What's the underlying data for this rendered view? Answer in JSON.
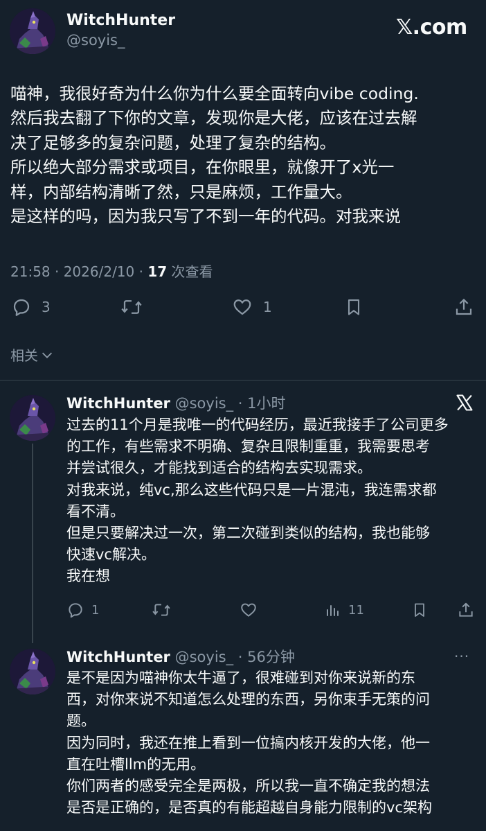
{
  "main_post": {
    "author_name": "WitchHunter",
    "author_handle": "@soyis_",
    "brand_label": "𝕏.com",
    "text_lines": [
      "喵神，我很好奇为什么你为什么要全面转向vibe coding.",
      "然后我去翻了下你的文章，发现你是大佬，应该在过去解",
      "决了足够多的复杂问题，处理了复杂的结构。",
      "所以绝大部分需求或项目，在你眼里，就像开了x光一",
      "样，内部结构清晰了然，只是麻烦，工作量大。",
      "是这样的吗，因为我只写了不到一年的代码。对我来说"
    ],
    "timestamp": "21:58 · 2026/2/10 · ",
    "view_count": "17",
    "view_label": " 次查看",
    "reply_count": "3",
    "like_count": "1",
    "related_label": "相关"
  },
  "replies": [
    {
      "author_name": "WitchHunter",
      "author_handle": "@soyis_",
      "time": " · 1小时",
      "text_lines": [
        "过去的11个月是我唯一的代码经历，最近我接手了公司更多",
        "的工作，有些需求不明确、复杂且限制重重，我需要思考",
        "并尝试很久，才能找到适合的结构去实现需求。",
        "对我来说，纯vc,那么这些代码只是一片混沌，我连需求都",
        "看不清。",
        "但是只要解决过一次，第二次碰到类似的结构，我也能够",
        "快速vc解决。",
        "我在想"
      ],
      "reply_count": "1",
      "view_count": "11"
    },
    {
      "author_name": "WitchHunter",
      "author_handle": "@soyis_",
      "time": " · 56分钟",
      "more_label": "···",
      "text_lines": [
        "是不是因为喵神你太牛逼了，很难碰到对你来说新的东",
        "西，对你来说不知道怎么处理的东西，另你束手无策的问",
        "题。",
        "因为同时，我还在推上看到一位搞内核开发的大佬，他一",
        "直在吐槽llm的无用。",
        "你们两者的感受完全是两极，所以我一直不确定我的想法",
        "是否是正确的，是否真的有能超越自身能力限制的vc架构"
      ]
    }
  ],
  "colors": {
    "background": "#15202b",
    "text_primary": "#f7f9f9",
    "text_secondary": "#8b98a5",
    "divider": "#38444d"
  },
  "icons": [
    "avatar-image",
    "x-logo",
    "reply-icon",
    "retweet-icon",
    "like-icon",
    "bookmark-icon",
    "share-icon",
    "views-icon",
    "chevron-down-icon",
    "more-icon"
  ]
}
